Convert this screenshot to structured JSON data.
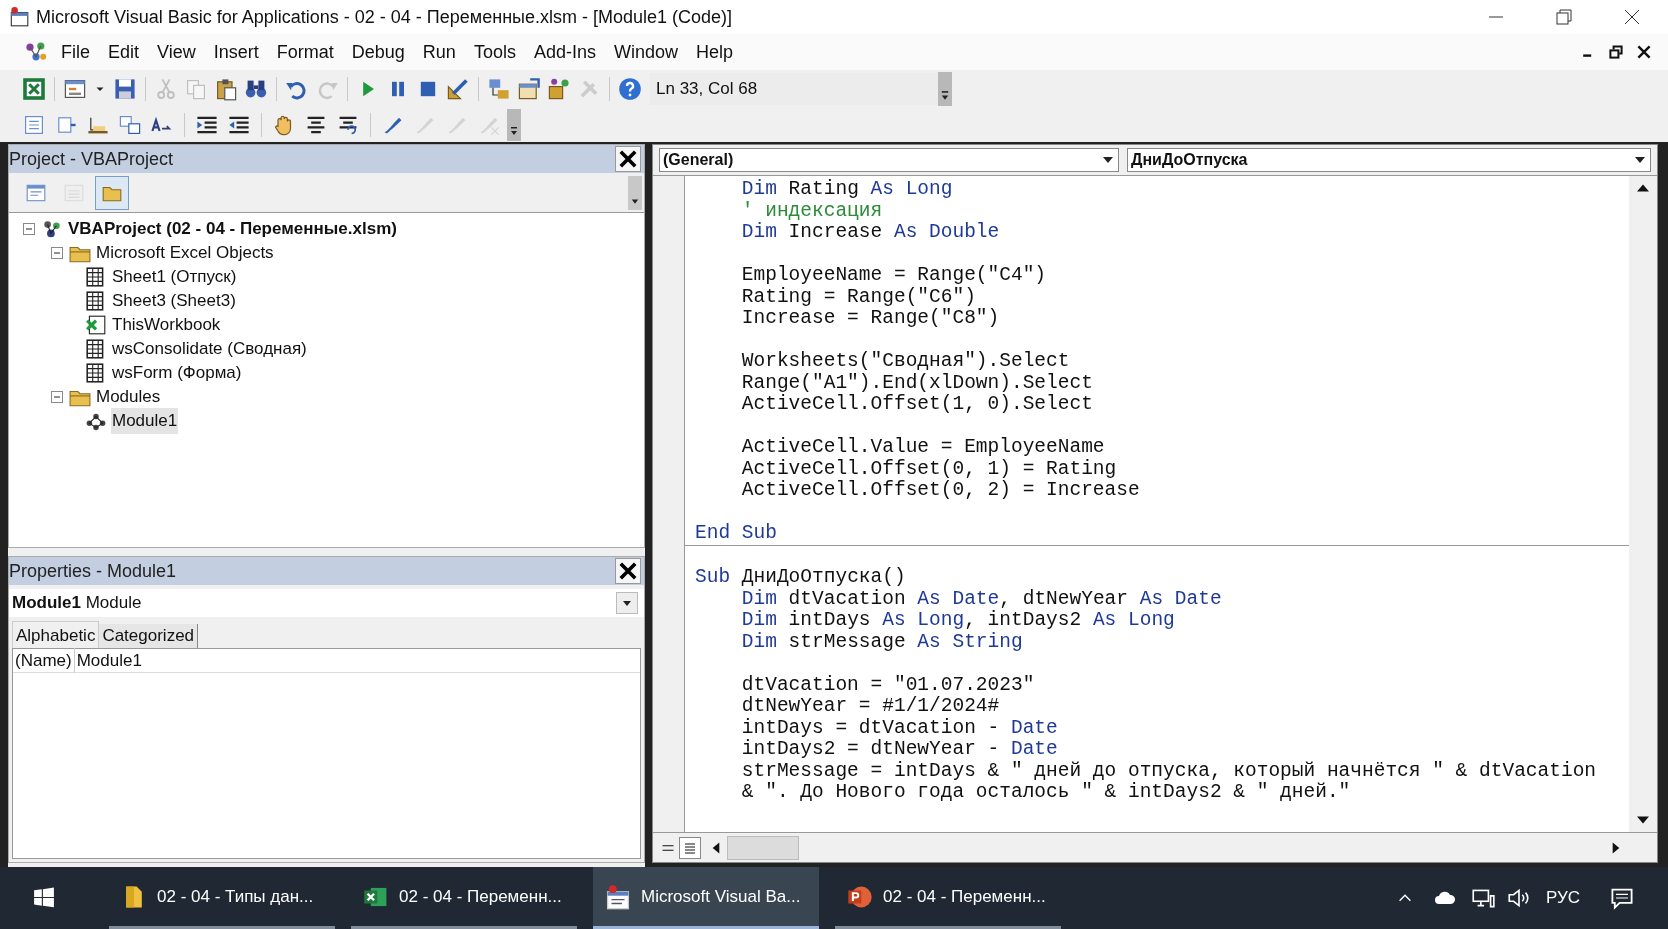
{
  "window": {
    "title": "Microsoft Visual Basic for Applications - 02 - 04 - Переменные.xlsm - [Module1 (Code)]"
  },
  "menu": [
    "File",
    "Edit",
    "View",
    "Insert",
    "Format",
    "Debug",
    "Run",
    "Tools",
    "Add-Ins",
    "Window",
    "Help"
  ],
  "toolbar_standard": [
    {
      "kind": "excel",
      "disabled": false
    },
    {
      "kind": "separator"
    },
    {
      "kind": "insert-form",
      "disabled": false
    },
    {
      "kind": "dropdown",
      "disabled": false
    },
    {
      "kind": "save",
      "disabled": false
    },
    {
      "kind": "separator"
    },
    {
      "kind": "cut",
      "disabled": true
    },
    {
      "kind": "copy",
      "disabled": true
    },
    {
      "kind": "paste",
      "disabled": false
    },
    {
      "kind": "find",
      "disabled": false
    },
    {
      "kind": "separator"
    },
    {
      "kind": "undo",
      "disabled": false
    },
    {
      "kind": "redo",
      "disabled": true
    },
    {
      "kind": "separator"
    },
    {
      "kind": "run",
      "disabled": false
    },
    {
      "kind": "pause",
      "disabled": false
    },
    {
      "kind": "stop",
      "disabled": false
    },
    {
      "kind": "design",
      "disabled": false
    },
    {
      "kind": "separator"
    },
    {
      "kind": "explorer",
      "disabled": false
    },
    {
      "kind": "properties",
      "disabled": false
    },
    {
      "kind": "browser",
      "disabled": false
    },
    {
      "kind": "toolbox",
      "disabled": true
    },
    {
      "kind": "separator"
    },
    {
      "kind": "help",
      "disabled": false
    }
  ],
  "cursor_position": "Ln 33, Col 68",
  "toolbar_edit": [
    {
      "kind": "list-members",
      "disabled": false
    },
    {
      "kind": "list-constants",
      "disabled": false
    },
    {
      "kind": "quick-info",
      "disabled": false
    },
    {
      "kind": "parameter-info",
      "disabled": false
    },
    {
      "kind": "complete-word",
      "disabled": false
    },
    {
      "kind": "separator"
    },
    {
      "kind": "indent",
      "disabled": false
    },
    {
      "kind": "outdent",
      "disabled": false
    },
    {
      "kind": "separator"
    },
    {
      "kind": "breakpoint",
      "disabled": false
    },
    {
      "kind": "comment-block",
      "disabled": false
    },
    {
      "kind": "uncomment-block",
      "disabled": false
    },
    {
      "kind": "separator"
    },
    {
      "kind": "bookmark",
      "disabled": false
    },
    {
      "kind": "next-bookmark",
      "disabled": true
    },
    {
      "kind": "previous-bookmark",
      "disabled": true
    },
    {
      "kind": "clear-bookmarks",
      "disabled": true
    }
  ],
  "project_explorer": {
    "title": "Project - VBAProject",
    "view_buttons": [
      {
        "kind": "view-code",
        "disabled": false,
        "selected": false
      },
      {
        "kind": "view-object",
        "disabled": true,
        "selected": false
      },
      {
        "kind": "toggle-folders",
        "disabled": false,
        "selected": true
      }
    ],
    "tree": [
      {
        "label": "VBAProject (02 - 04 - Переменные.xlsm)",
        "kind": "project",
        "expanded": true,
        "selected": false,
        "children": [
          {
            "label": "Microsoft Excel Objects",
            "kind": "folder",
            "expanded": true,
            "selected": false,
            "children": [
              {
                "label": "Sheet1 (Отпуск)",
                "kind": "sheet",
                "selected": false
              },
              {
                "label": "Sheet3 (Sheet3)",
                "kind": "sheet",
                "selected": false
              },
              {
                "label": "ThisWorkbook",
                "kind": "workbook",
                "selected": false
              },
              {
                "label": "wsConsolidate (Сводная)",
                "kind": "sheet",
                "selected": false
              },
              {
                "label": "wsForm (Форма)",
                "kind": "sheet",
                "selected": false
              }
            ]
          },
          {
            "label": "Modules",
            "kind": "folder",
            "expanded": true,
            "selected": false,
            "children": [
              {
                "label": "Module1",
                "kind": "module",
                "selected": true
              }
            ]
          }
        ]
      }
    ]
  },
  "properties": {
    "title": "Properties - Module1",
    "object_name": "Module1",
    "object_type": "Module",
    "tabs": [
      {
        "label": "Alphabetic",
        "selected": true
      },
      {
        "label": "Categorized",
        "selected": false
      }
    ],
    "rows": [
      {
        "name": "(Name)",
        "value": "Module1"
      }
    ]
  },
  "code_window": {
    "object_dropdown": "(General)",
    "procedure_dropdown": "ДниДоОтпуска",
    "procedures": [
      {
        "lines": [
          {
            "kind": "code",
            "tokens": [
              {
                "text": "    Dim",
                "kind": "keyword"
              },
              {
                "text": " Rating ",
                "kind": "plain"
              },
              {
                "text": "As Long",
                "kind": "keyword"
              }
            ]
          },
          {
            "kind": "code",
            "tokens": [
              {
                "text": "    ' индексация",
                "kind": "comment"
              }
            ]
          },
          {
            "kind": "code",
            "tokens": [
              {
                "text": "    Dim",
                "kind": "keyword"
              },
              {
                "text": " Increase ",
                "kind": "plain"
              },
              {
                "text": "As Double",
                "kind": "keyword"
              }
            ]
          },
          {
            "kind": "blank"
          },
          {
            "kind": "code",
            "tokens": [
              {
                "text": "    EmployeeName = Range(\"C4\")",
                "kind": "plain"
              }
            ]
          },
          {
            "kind": "code",
            "tokens": [
              {
                "text": "    Rating = Range(\"C6\")",
                "kind": "plain"
              }
            ]
          },
          {
            "kind": "code",
            "tokens": [
              {
                "text": "    Increase = Range(\"C8\")",
                "kind": "plain"
              }
            ]
          },
          {
            "kind": "blank"
          },
          {
            "kind": "code",
            "tokens": [
              {
                "text": "    Worksheets(\"Сводная\").Select",
                "kind": "plain"
              }
            ]
          },
          {
            "kind": "code",
            "tokens": [
              {
                "text": "    Range(\"A1\").End(xlDown).Select",
                "kind": "plain"
              }
            ]
          },
          {
            "kind": "code",
            "tokens": [
              {
                "text": "    ActiveCell.Offset(1, 0).Select",
                "kind": "plain"
              }
            ]
          },
          {
            "kind": "blank"
          },
          {
            "kind": "code",
            "tokens": [
              {
                "text": "    ActiveCell.Value = EmployeeName",
                "kind": "plain"
              }
            ]
          },
          {
            "kind": "code",
            "tokens": [
              {
                "text": "    ActiveCell.Offset(0, 1) = Rating",
                "kind": "plain"
              }
            ]
          },
          {
            "kind": "code",
            "tokens": [
              {
                "text": "    ActiveCell.Offset(0, 2) = Increase",
                "kind": "plain"
              }
            ]
          },
          {
            "kind": "blank"
          },
          {
            "kind": "code",
            "tokens": [
              {
                "text": "End Sub",
                "kind": "keyword"
              }
            ]
          }
        ]
      },
      {
        "lines": [
          {
            "kind": "blank"
          },
          {
            "kind": "code",
            "tokens": [
              {
                "text": "Sub",
                "kind": "keyword"
              },
              {
                "text": " ДниДоОтпуска()",
                "kind": "plain"
              }
            ]
          },
          {
            "kind": "code",
            "tokens": [
              {
                "text": "    Dim",
                "kind": "keyword"
              },
              {
                "text": " dtVacation ",
                "kind": "plain"
              },
              {
                "text": "As Date",
                "kind": "keyword"
              },
              {
                "text": ", dtNewYear ",
                "kind": "plain"
              },
              {
                "text": "As Date",
                "kind": "keyword"
              }
            ]
          },
          {
            "kind": "code",
            "tokens": [
              {
                "text": "    Dim",
                "kind": "keyword"
              },
              {
                "text": " intDays ",
                "kind": "plain"
              },
              {
                "text": "As Long",
                "kind": "keyword"
              },
              {
                "text": ", intDays2 ",
                "kind": "plain"
              },
              {
                "text": "As Long",
                "kind": "keyword"
              }
            ]
          },
          {
            "kind": "code",
            "tokens": [
              {
                "text": "    Dim",
                "kind": "keyword"
              },
              {
                "text": " strMessage ",
                "kind": "plain"
              },
              {
                "text": "As String",
                "kind": "keyword"
              }
            ]
          },
          {
            "kind": "blank"
          },
          {
            "kind": "code",
            "tokens": [
              {
                "text": "    dtVacation = \"01.07.2023\"",
                "kind": "plain"
              }
            ]
          },
          {
            "kind": "code",
            "tokens": [
              {
                "text": "    dtNewYear = #1/1/2024#",
                "kind": "plain"
              }
            ]
          },
          {
            "kind": "code",
            "tokens": [
              {
                "text": "    intDays = dtVacation - ",
                "kind": "plain"
              },
              {
                "text": "Date",
                "kind": "keyword"
              }
            ]
          },
          {
            "kind": "code",
            "tokens": [
              {
                "text": "    intDays2 = dtNewYear - ",
                "kind": "plain"
              },
              {
                "text": "Date",
                "kind": "keyword"
              }
            ]
          },
          {
            "kind": "code",
            "tokens": [
              {
                "text": "    strMessage = intDays & \" дней до отпуска, который начнётся \" & dtVacation",
                "kind": "plain"
              }
            ]
          },
          {
            "kind": "code",
            "tokens": [
              {
                "text": "    & \". До Нового года осталось \" & intDays2 & \" дней.\"",
                "kind": "plain"
              }
            ]
          }
        ]
      }
    ]
  },
  "taskbar": {
    "items": [
      {
        "label": "02 - 04 - Типы дан...",
        "kind": "folder",
        "selected": false
      },
      {
        "label": "02 - 04 - Переменн...",
        "kind": "excel",
        "selected": false
      },
      {
        "label": "Microsoft Visual Ba...",
        "kind": "vba",
        "selected": true
      },
      {
        "label": "02 - 04 - Переменн...",
        "kind": "powerpoint",
        "selected": false
      }
    ],
    "language": "РУС"
  }
}
